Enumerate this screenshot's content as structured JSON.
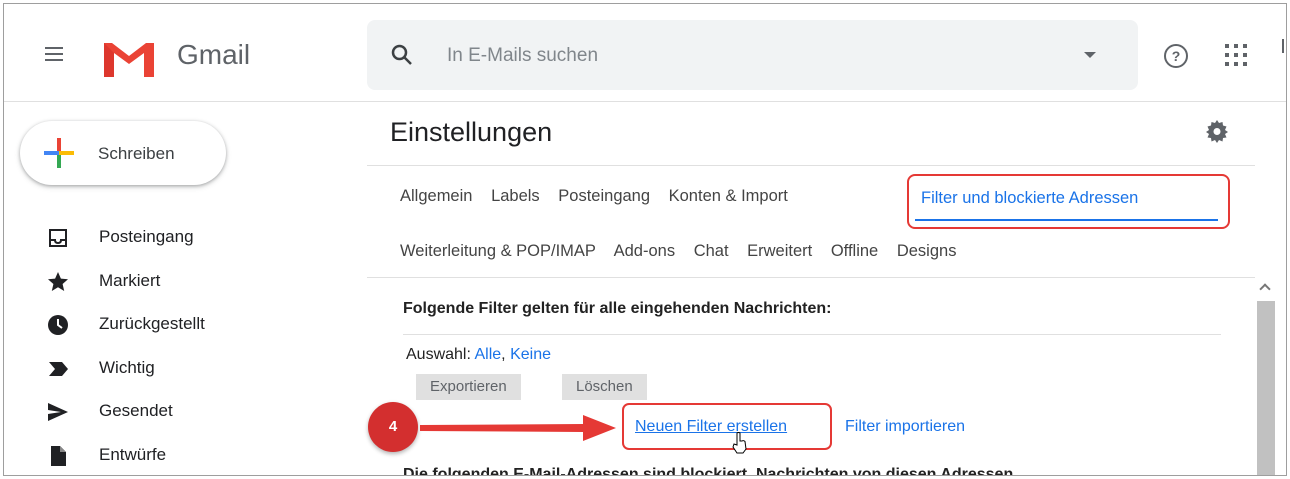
{
  "header": {
    "app_name": "Gmail",
    "search_placeholder": "In E-Mails suchen"
  },
  "compose": {
    "label": "Schreiben"
  },
  "sidebar": {
    "items": [
      {
        "label": "Posteingang",
        "icon": "inbox-icon"
      },
      {
        "label": "Markiert",
        "icon": "star-icon"
      },
      {
        "label": "Zurückgestellt",
        "icon": "clock-icon"
      },
      {
        "label": "Wichtig",
        "icon": "important-icon"
      },
      {
        "label": "Gesendet",
        "icon": "send-icon"
      },
      {
        "label": "Entwürfe",
        "icon": "draft-icon"
      }
    ]
  },
  "settings": {
    "title": "Einstellungen",
    "tabs_row1": [
      "Allgemein",
      "Labels",
      "Posteingang",
      "Konten & Import"
    ],
    "active_tab": "Filter und blockierte Adressen",
    "tabs_row2": [
      "Weiterleitung & POP/IMAP",
      "Add-ons",
      "Chat",
      "Erweitert",
      "Offline",
      "Designs"
    ],
    "filter_heading": "Folgende Filter gelten für alle eingehenden Nachrichten:",
    "selection_label": "Auswahl:",
    "select_all": "Alle",
    "select_separator": ",",
    "select_none": "Keine",
    "export_button": "Exportieren",
    "delete_button": "Löschen",
    "create_filter": "Neuen Filter erstellen",
    "import_filter": "Filter importieren",
    "blocked_heading": "Die folgenden E-Mail-Adressen sind blockiert. Nachrichten von diesen Adressen"
  },
  "annotation": {
    "step_number": "4",
    "color": "#e53935"
  },
  "colors": {
    "link": "#1a73e8",
    "accent_red": "#e53935"
  }
}
